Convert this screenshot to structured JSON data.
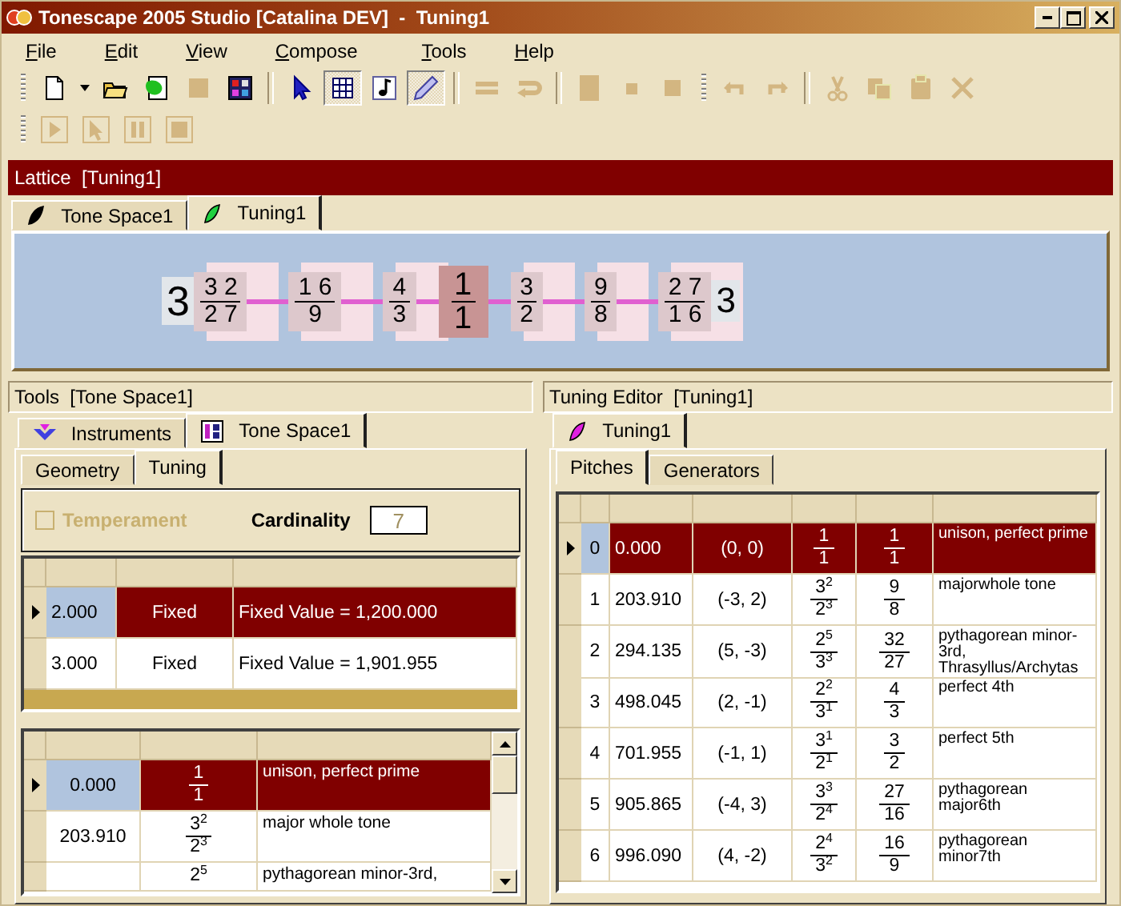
{
  "window": {
    "title": "Tonescape 2005 Studio [Catalina DEV]  -  Tuning1"
  },
  "menu": [
    "File",
    "Edit",
    "View",
    "Compose",
    "Tools",
    "Help"
  ],
  "toolbars": [
    [
      {
        "kind": "grip"
      },
      {
        "kind": "button",
        "pressed": false,
        "disabled": false
      },
      {
        "kind": "caret"
      },
      {
        "kind": "button",
        "pressed": false,
        "disabled": false
      },
      {
        "kind": "button",
        "pressed": false,
        "disabled": false
      },
      {
        "kind": "button",
        "pressed": false,
        "disabled": true
      },
      {
        "kind": "button",
        "pressed": false,
        "disabled": false
      },
      {
        "kind": "separator"
      },
      {
        "kind": "button",
        "pressed": false,
        "disabled": false
      },
      {
        "kind": "button",
        "pressed": true,
        "disabled": false
      },
      {
        "kind": "button",
        "pressed": false,
        "disabled": false
      },
      {
        "kind": "button",
        "pressed": true,
        "disabled": false
      },
      {
        "kind": "separator"
      },
      {
        "kind": "button",
        "pressed": false,
        "disabled": true
      },
      {
        "kind": "button",
        "pressed": false,
        "disabled": true
      },
      {
        "kind": "separator"
      },
      {
        "kind": "button",
        "pressed": false,
        "disabled": true
      },
      {
        "kind": "button",
        "pressed": false,
        "disabled": true
      },
      {
        "kind": "button",
        "pressed": false,
        "disabled": true
      },
      {
        "kind": "grip"
      },
      {
        "kind": "button",
        "pressed": false,
        "disabled": true
      },
      {
        "kind": "button",
        "pressed": false,
        "disabled": true
      },
      {
        "kind": "separator"
      },
      {
        "kind": "button",
        "pressed": false,
        "disabled": true
      },
      {
        "kind": "button",
        "pressed": false,
        "disabled": true
      },
      {
        "kind": "button",
        "pressed": false,
        "disabled": true
      },
      {
        "kind": "button",
        "pressed": false,
        "disabled": true
      }
    ],
    [
      {
        "kind": "grip"
      },
      {
        "kind": "button",
        "pressed": false,
        "disabled": true
      },
      {
        "kind": "button",
        "pressed": false,
        "disabled": true
      },
      {
        "kind": "button",
        "pressed": false,
        "disabled": true
      },
      {
        "kind": "button",
        "pressed": false,
        "disabled": true
      }
    ]
  ],
  "lattice": {
    "title": "Lattice  [Tuning1]",
    "tabs": [
      {
        "label": "Tone Space1",
        "selected": false
      },
      {
        "label": "Tuning1",
        "selected": true
      }
    ],
    "left_label": "3",
    "right_label": "3",
    "nodes": [
      {
        "num": "3 2",
        "den": "2 7",
        "selected": false
      },
      {
        "num": "1 6",
        "den": "9",
        "selected": false
      },
      {
        "num": "4",
        "den": "3",
        "selected": false
      },
      {
        "num": "1",
        "den": "1",
        "selected": true
      },
      {
        "num": "3",
        "den": "2",
        "selected": false
      },
      {
        "num": "9",
        "den": "8",
        "selected": false
      },
      {
        "num": "2 7",
        "den": "1 6",
        "selected": false
      }
    ]
  },
  "tools": {
    "title": "Tools  [Tone Space1]",
    "tabs": [
      {
        "label": "Instruments",
        "selected": false
      },
      {
        "label": "Tone Space1",
        "selected": true
      }
    ],
    "subtabs": [
      {
        "label": "Geometry",
        "selected": false
      },
      {
        "label": "Tuning",
        "selected": true
      }
    ],
    "temperament": {
      "label": "Temperament",
      "checked": false,
      "disabled": true
    },
    "cardinality": {
      "label": "Cardinality",
      "value": "7"
    },
    "generators": [
      {
        "value": "2.000",
        "type": "Fixed",
        "description": "Fixed Value = 1,200.000",
        "selected": true
      },
      {
        "value": "3.000",
        "type": "Fixed",
        "description": "Fixed Value = 1,901.955",
        "selected": false
      }
    ],
    "pitches": [
      {
        "cents": "0.000",
        "num": "1",
        "den": "1",
        "description": "unison, perfect prime",
        "selected": true
      },
      {
        "cents": "203.910",
        "num": "3$^{2}$",
        "den": "2$^{3}$",
        "description": "major whole tone",
        "selected": false
      },
      {
        "num": "2$^{5}$",
        "description": "pythagorean minor-3rd,",
        "selected": false
      }
    ]
  },
  "tuning_editor": {
    "title": "Tuning Editor  [Tuning1]",
    "tabs": [
      {
        "label": "Tuning1",
        "selected": true
      }
    ],
    "subtabs": [
      {
        "label": "Pitches",
        "selected": true
      },
      {
        "label": "Generators",
        "selected": false
      }
    ],
    "pitches": [
      {
        "index": "0",
        "cents": "0.000",
        "monzo": "(0, 0)",
        "prime_num": "1",
        "prime_den": "1",
        "num": "1",
        "den": "1",
        "description": "unison, perfect prime",
        "selected": true
      },
      {
        "index": "1",
        "cents": "203.910",
        "monzo": "(-3, 2)",
        "prime_num": "3$^{2}$",
        "prime_den": "2$^{3}$",
        "num": "9",
        "den": "8",
        "description": "majorwhole tone",
        "selected": false
      },
      {
        "index": "2",
        "cents": "294.135",
        "monzo": "(5, -3)",
        "prime_num": "2$^{5}$",
        "prime_den": "3$^{3}$",
        "num": "32",
        "den": "27",
        "description": "pythagorean minor-3rd, Thrasyllus/Archytas",
        "selected": false
      },
      {
        "index": "3",
        "cents": "498.045",
        "monzo": "(2, -1)",
        "prime_num": "2$^{2}$",
        "prime_den": "3$^{1}$",
        "num": "4",
        "den": "3",
        "description": "perfect 4th",
        "selected": false
      },
      {
        "index": "4",
        "cents": "701.955",
        "monzo": "(-1, 1)",
        "prime_num": "3$^{1}$",
        "prime_den": "2$^{1}$",
        "num": "3",
        "den": "2",
        "description": "perfect 5th",
        "selected": false
      },
      {
        "index": "5",
        "cents": "905.865",
        "monzo": "(-4, 3)",
        "prime_num": "3$^{3}$",
        "prime_den": "2$^{4}$",
        "num": "27",
        "den": "16",
        "description": "pythagorean major6th",
        "selected": false
      },
      {
        "index": "6",
        "cents": "996.090",
        "monzo": "(4, -2)",
        "prime_num": "2$^{4}$",
        "prime_den": "3$^{2}$",
        "num": "16",
        "den": "9",
        "description": "pythagorean minor7th",
        "selected": false
      }
    ]
  }
}
